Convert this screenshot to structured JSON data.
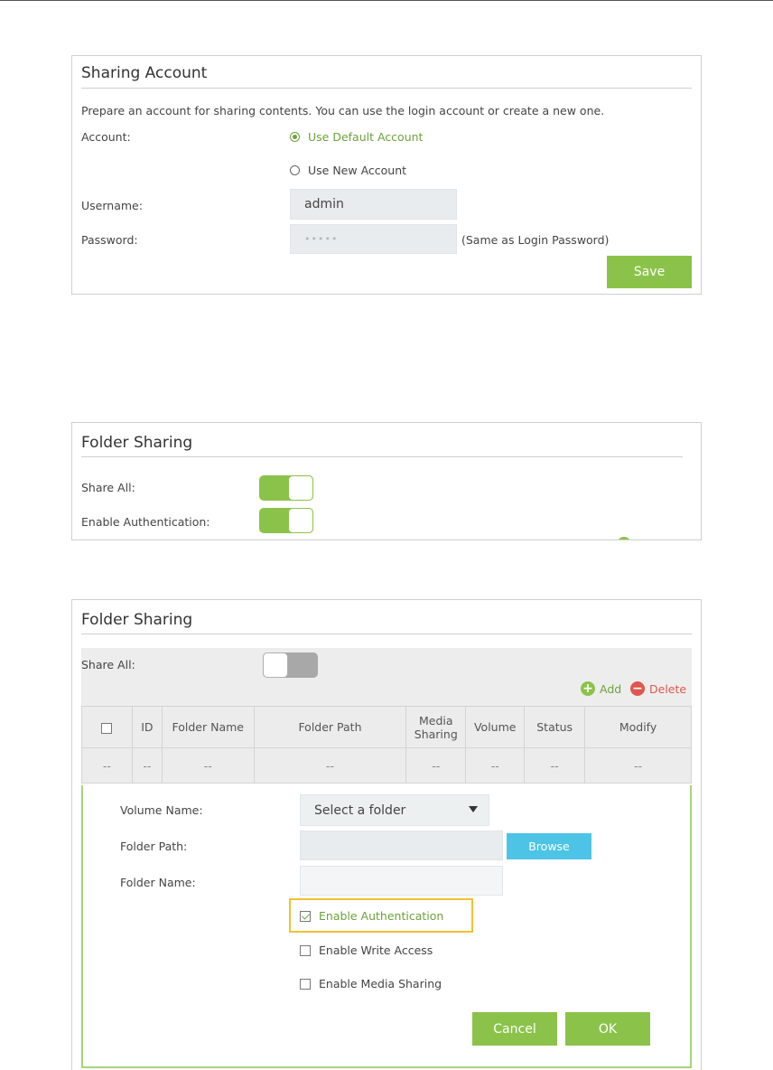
{
  "sharing_account": {
    "title": "Sharing Account",
    "description": "Prepare an account for sharing contents. You can use the login account or create a new one.",
    "account_label": "Account:",
    "options": [
      "Use Default Account",
      "Use New Account"
    ],
    "selected_option": "Use Default Account",
    "username_label": "Username:",
    "username_value": "admin",
    "password_label": "Password:",
    "password_value": "•••••",
    "password_note": "(Same as Login Password)",
    "save_label": "Save"
  },
  "folder_sharing_1": {
    "title": "Folder Sharing",
    "share_all_label": "Share All:",
    "share_all_on": true,
    "auth_label": "Enable Authentication:",
    "auth_on": true
  },
  "folder_sharing_2": {
    "title": "Folder Sharing",
    "share_all_label": "Share All:",
    "share_all_on": false,
    "add_label": "Add",
    "delete_label": "Delete",
    "columns": [
      "ID",
      "Folder Name",
      "Folder Path",
      "Media Sharing",
      "Volume",
      "Status",
      "Modify"
    ],
    "empty_row": [
      "--",
      "--",
      "--",
      "--",
      "--",
      "--",
      "--",
      "--"
    ],
    "form": {
      "volume_label": "Volume Name:",
      "volume_select": "Select a folder",
      "path_label": "Folder Path:",
      "path_value": "",
      "browse_label": "Browse",
      "name_label": "Folder Name:",
      "name_value": "",
      "enable_auth_label": "Enable Authentication",
      "enable_auth_checked": true,
      "enable_write_label": "Enable Write Access",
      "enable_write_checked": false,
      "enable_media_label": "Enable Media Sharing",
      "enable_media_checked": false,
      "cancel_label": "Cancel",
      "ok_label": "OK"
    }
  },
  "colors": {
    "accent_green": "#8bc34a",
    "text_green": "#6da23c",
    "browse_blue": "#4dc4e6",
    "highlight_yellow": "#f2c230",
    "delete_red": "#e0574f"
  }
}
